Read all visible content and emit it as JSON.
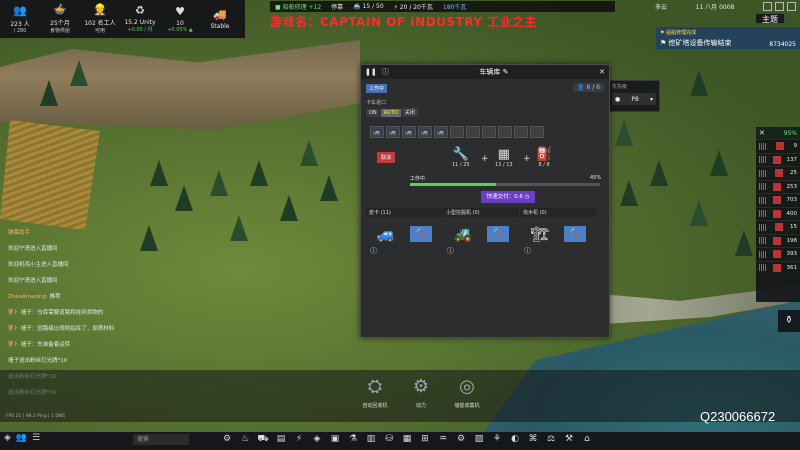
{
  "hud": {
    "stats": [
      {
        "icon": "people-icon",
        "glyph": "👥",
        "value": "223 人",
        "sub": "/ 280"
      },
      {
        "icon": "food-icon",
        "glyph": "🍲",
        "value": "25个月",
        "sub": "食物供给"
      },
      {
        "icon": "workers-icon",
        "glyph": "👷",
        "value": "102 名工人",
        "sub": "可用"
      },
      {
        "icon": "recycle-icon",
        "glyph": "♻",
        "value": "15.2 Unity",
        "sub": "+0.00 / 月"
      },
      {
        "icon": "heart-icon",
        "glyph": "♥",
        "value": "10",
        "sub": "+0.05% ▲"
      },
      {
        "icon": "truck-icon",
        "glyph": "🚚",
        "value": "Stable",
        "sub": ""
      }
    ]
  },
  "resource_bar": {
    "green_label": "■ 船舶修理 +12",
    "status": "停靠",
    "ships": "🚢 15 / 50",
    "power": "⚡ 20 / 20千瓦",
    "blue_label": "180千瓦"
  },
  "overlay_title": "游戏名：CAPTAIN OF INDUSTRY 工业之主",
  "top_right": {
    "weather": "多云",
    "date": "11 八月 0008"
  },
  "channel_badge": "主题",
  "banner": {
    "line1": "⚑ 船舶修理完成",
    "line2": "⚑ 挖矿塔设备传输结束",
    "line3": "8734025"
  },
  "side_panel": {
    "percent": "95%",
    "rows": [
      {
        "value": "9"
      },
      {
        "value": "137"
      },
      {
        "value": "25"
      },
      {
        "value": "253"
      },
      {
        "value": "703"
      },
      {
        "value": "400"
      },
      {
        "value": "15"
      },
      {
        "value": "198"
      },
      {
        "value": "393"
      },
      {
        "value": "361"
      }
    ]
  },
  "storage": {
    "label": "优先级",
    "value": "P8"
  },
  "garage": {
    "title": "车辆库 ✎",
    "status_tag": "工作中",
    "slot_count": "6 / 6",
    "section_label": "卡车进口",
    "toggle": [
      "ON",
      "AUTO",
      "关闭"
    ],
    "slots": [
      "🚙",
      "🚙",
      "🚙",
      "🚙",
      "🚙",
      "",
      "",
      "",
      "",
      "",
      ""
    ],
    "remove_btn": "取消",
    "requirements": [
      {
        "glyph": "🔧",
        "value": "11 / 25"
      },
      {
        "glyph": "▦",
        "value": "13 / 13"
      },
      {
        "glyph": "⛽",
        "value": "8 / 8"
      }
    ],
    "progress_label": "工作中",
    "progress_percent": "45%",
    "progress_value": 0.45,
    "boost_btn": "快速交付：0.6 ◷",
    "vehicles": [
      {
        "name": "皮卡 (11)",
        "glyph": "🚙",
        "action": "🔨"
      },
      {
        "name": "小型挖掘机 (0)",
        "glyph": "🚜",
        "action": "🔨"
      },
      {
        "name": "伐木机 (0)",
        "glyph": "🏗",
        "action": "🔨"
      }
    ]
  },
  "chat": [
    {
      "user": "弹幕助手",
      "msg": ""
    },
    {
      "user": "",
      "msg": "欢迎宁语进入直播间"
    },
    {
      "user": "",
      "msg": "欢迎机鸡小主进入直播间"
    },
    {
      "user": "",
      "msg": "欢迎宁语进入直播间"
    },
    {
      "user": "ZheoAmazing:",
      "msg": "推荐"
    },
    {
      "user": "萝卜",
      "msg": "墙子：仓库需要道路和挂到货物的"
    },
    {
      "user": "萝卜",
      "msg": "墙子：因路痕比规则指挥了，原质材料"
    },
    {
      "user": "萝卜",
      "msg": "墙子：先准备着运转"
    },
    {
      "user": "",
      "msg": "墙子送出粉丝灯光牌*10"
    },
    {
      "user": "",
      "msg": "送出粉丝灯光牌*10"
    },
    {
      "user": "",
      "msg": "送出粉丝灯光牌*50"
    }
  ],
  "build_items": [
    {
      "glyph": "⛭",
      "label": "自动回收机"
    },
    {
      "glyph": "⚙",
      "label": "动力"
    },
    {
      "glyph": "◎",
      "label": "储能收集机"
    }
  ],
  "search_placeholder": "搜索",
  "tools": [
    "⚙",
    "♨",
    "⛟",
    "▤",
    "⚡",
    "◈",
    "▣",
    "⚗",
    "▥",
    "⛁",
    "▦",
    "⊞",
    "♒",
    "⚙",
    "▨",
    "⚘",
    "◐",
    "⌘",
    "⚖",
    "⚒",
    "⌂"
  ],
  "qq": "Q230066672",
  "net_info": "FPS 21 | 98.1 Ping | 1 DNS"
}
